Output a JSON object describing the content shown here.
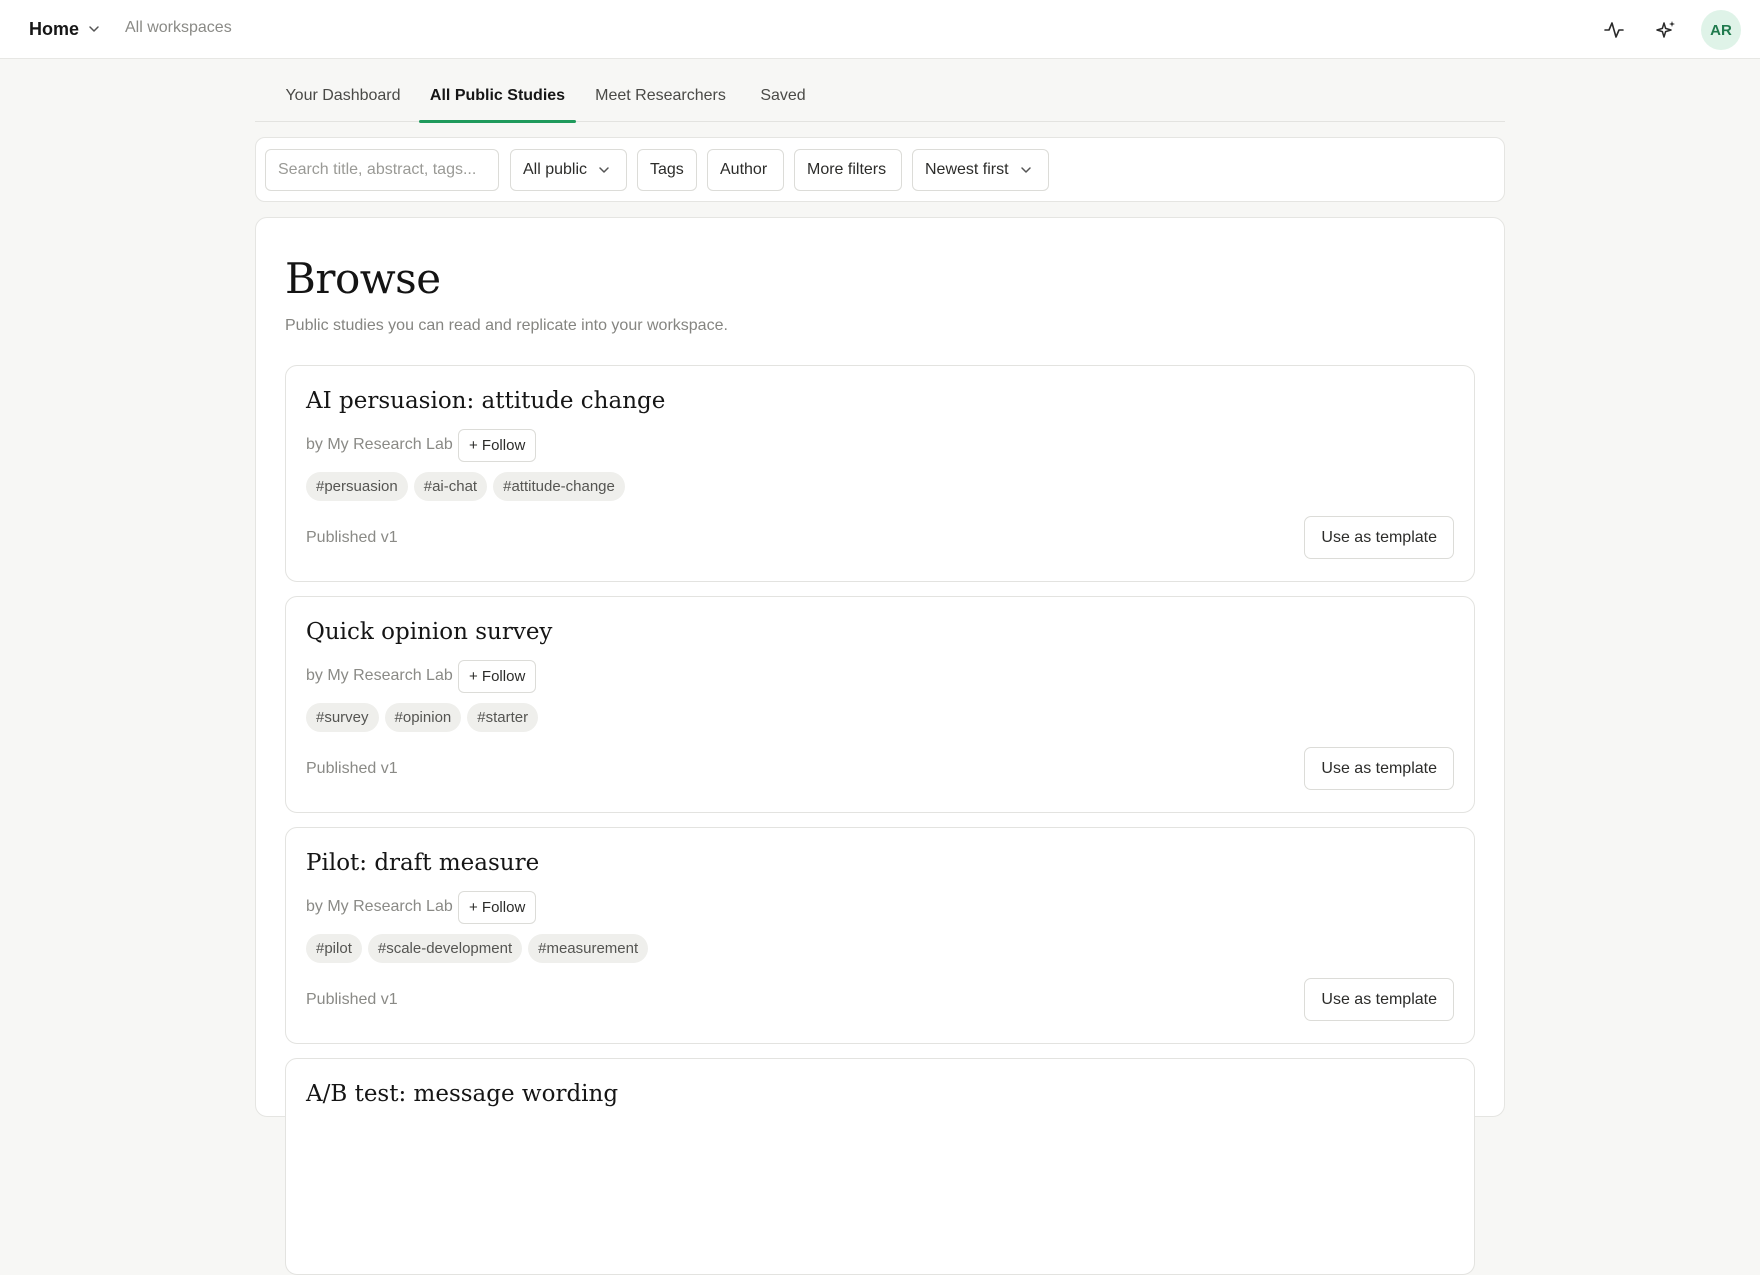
{
  "topbar": {
    "home_label": "Home",
    "workspaces_link": "All workspaces",
    "avatar_initials": "AR",
    "icons": [
      "activity-icon",
      "sparkles-icon"
    ]
  },
  "tabs": [
    {
      "label": "Your Dashboard",
      "active": false
    },
    {
      "label": "All Public Studies",
      "active": true
    },
    {
      "label": "Meet Researchers",
      "active": false
    },
    {
      "label": "Saved",
      "active": false
    }
  ],
  "filters": {
    "search_placeholder": "Search title, abstract, tags...",
    "visibility_select": "All public",
    "tags_button": "Tags",
    "author_button": "Author",
    "more_filters_button": "More filters",
    "sort_select": "Newest first"
  },
  "page": {
    "title": "Browse",
    "subtitle": "Public studies you can read and replicate into your workspace."
  },
  "studies": [
    {
      "title": "AI persuasion: attitude change",
      "author": "by My Research Lab",
      "follow_label": "+ Follow",
      "tags": [
        "#persuasion",
        "#ai-chat",
        "#attitude-change"
      ],
      "status": "Published v1",
      "action_label": "Use as template"
    },
    {
      "title": "Quick opinion survey",
      "author": "by My Research Lab",
      "follow_label": "+ Follow",
      "tags": [
        "#survey",
        "#opinion",
        "#starter"
      ],
      "status": "Published v1",
      "action_label": "Use as template"
    },
    {
      "title": "Pilot: draft measure",
      "author": "by My Research Lab",
      "follow_label": "+ Follow",
      "tags": [
        "#pilot",
        "#scale-development",
        "#measurement"
      ],
      "status": "Published v1",
      "action_label": "Use as template"
    },
    {
      "title": "A/B test: message wording",
      "author": "",
      "follow_label": "",
      "tags": [],
      "status": "",
      "action_label": ""
    }
  ],
  "colors": {
    "accent": "#1f9a5c",
    "avatar_bg": "#dff3e8",
    "avatar_text": "#1f7a4d",
    "page_bg": "#f7f7f5"
  }
}
